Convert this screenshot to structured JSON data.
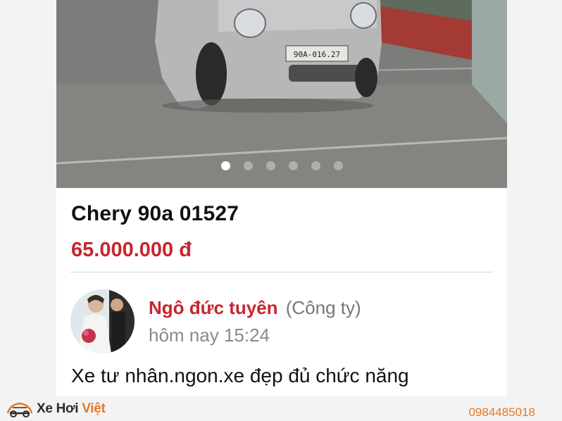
{
  "listing": {
    "title": "Chery 90a 01527",
    "price": "65.000.000 đ",
    "plate_text": "90A-016.27",
    "photo_count": 6,
    "active_photo_index": 0,
    "description": "Xe tư nhân.ngon.xe đẹp đủ chức năng"
  },
  "seller": {
    "name": "Ngô đức tuyên",
    "type": "(Công ty)",
    "posted_time": "hôm nay 15:24"
  },
  "footer": {
    "logo_part1": "Xe Hơi ",
    "logo_part2": "Việt",
    "phone": "0984485018"
  },
  "colors": {
    "accent_red": "#c8252c",
    "brand_orange": "#e87722"
  }
}
